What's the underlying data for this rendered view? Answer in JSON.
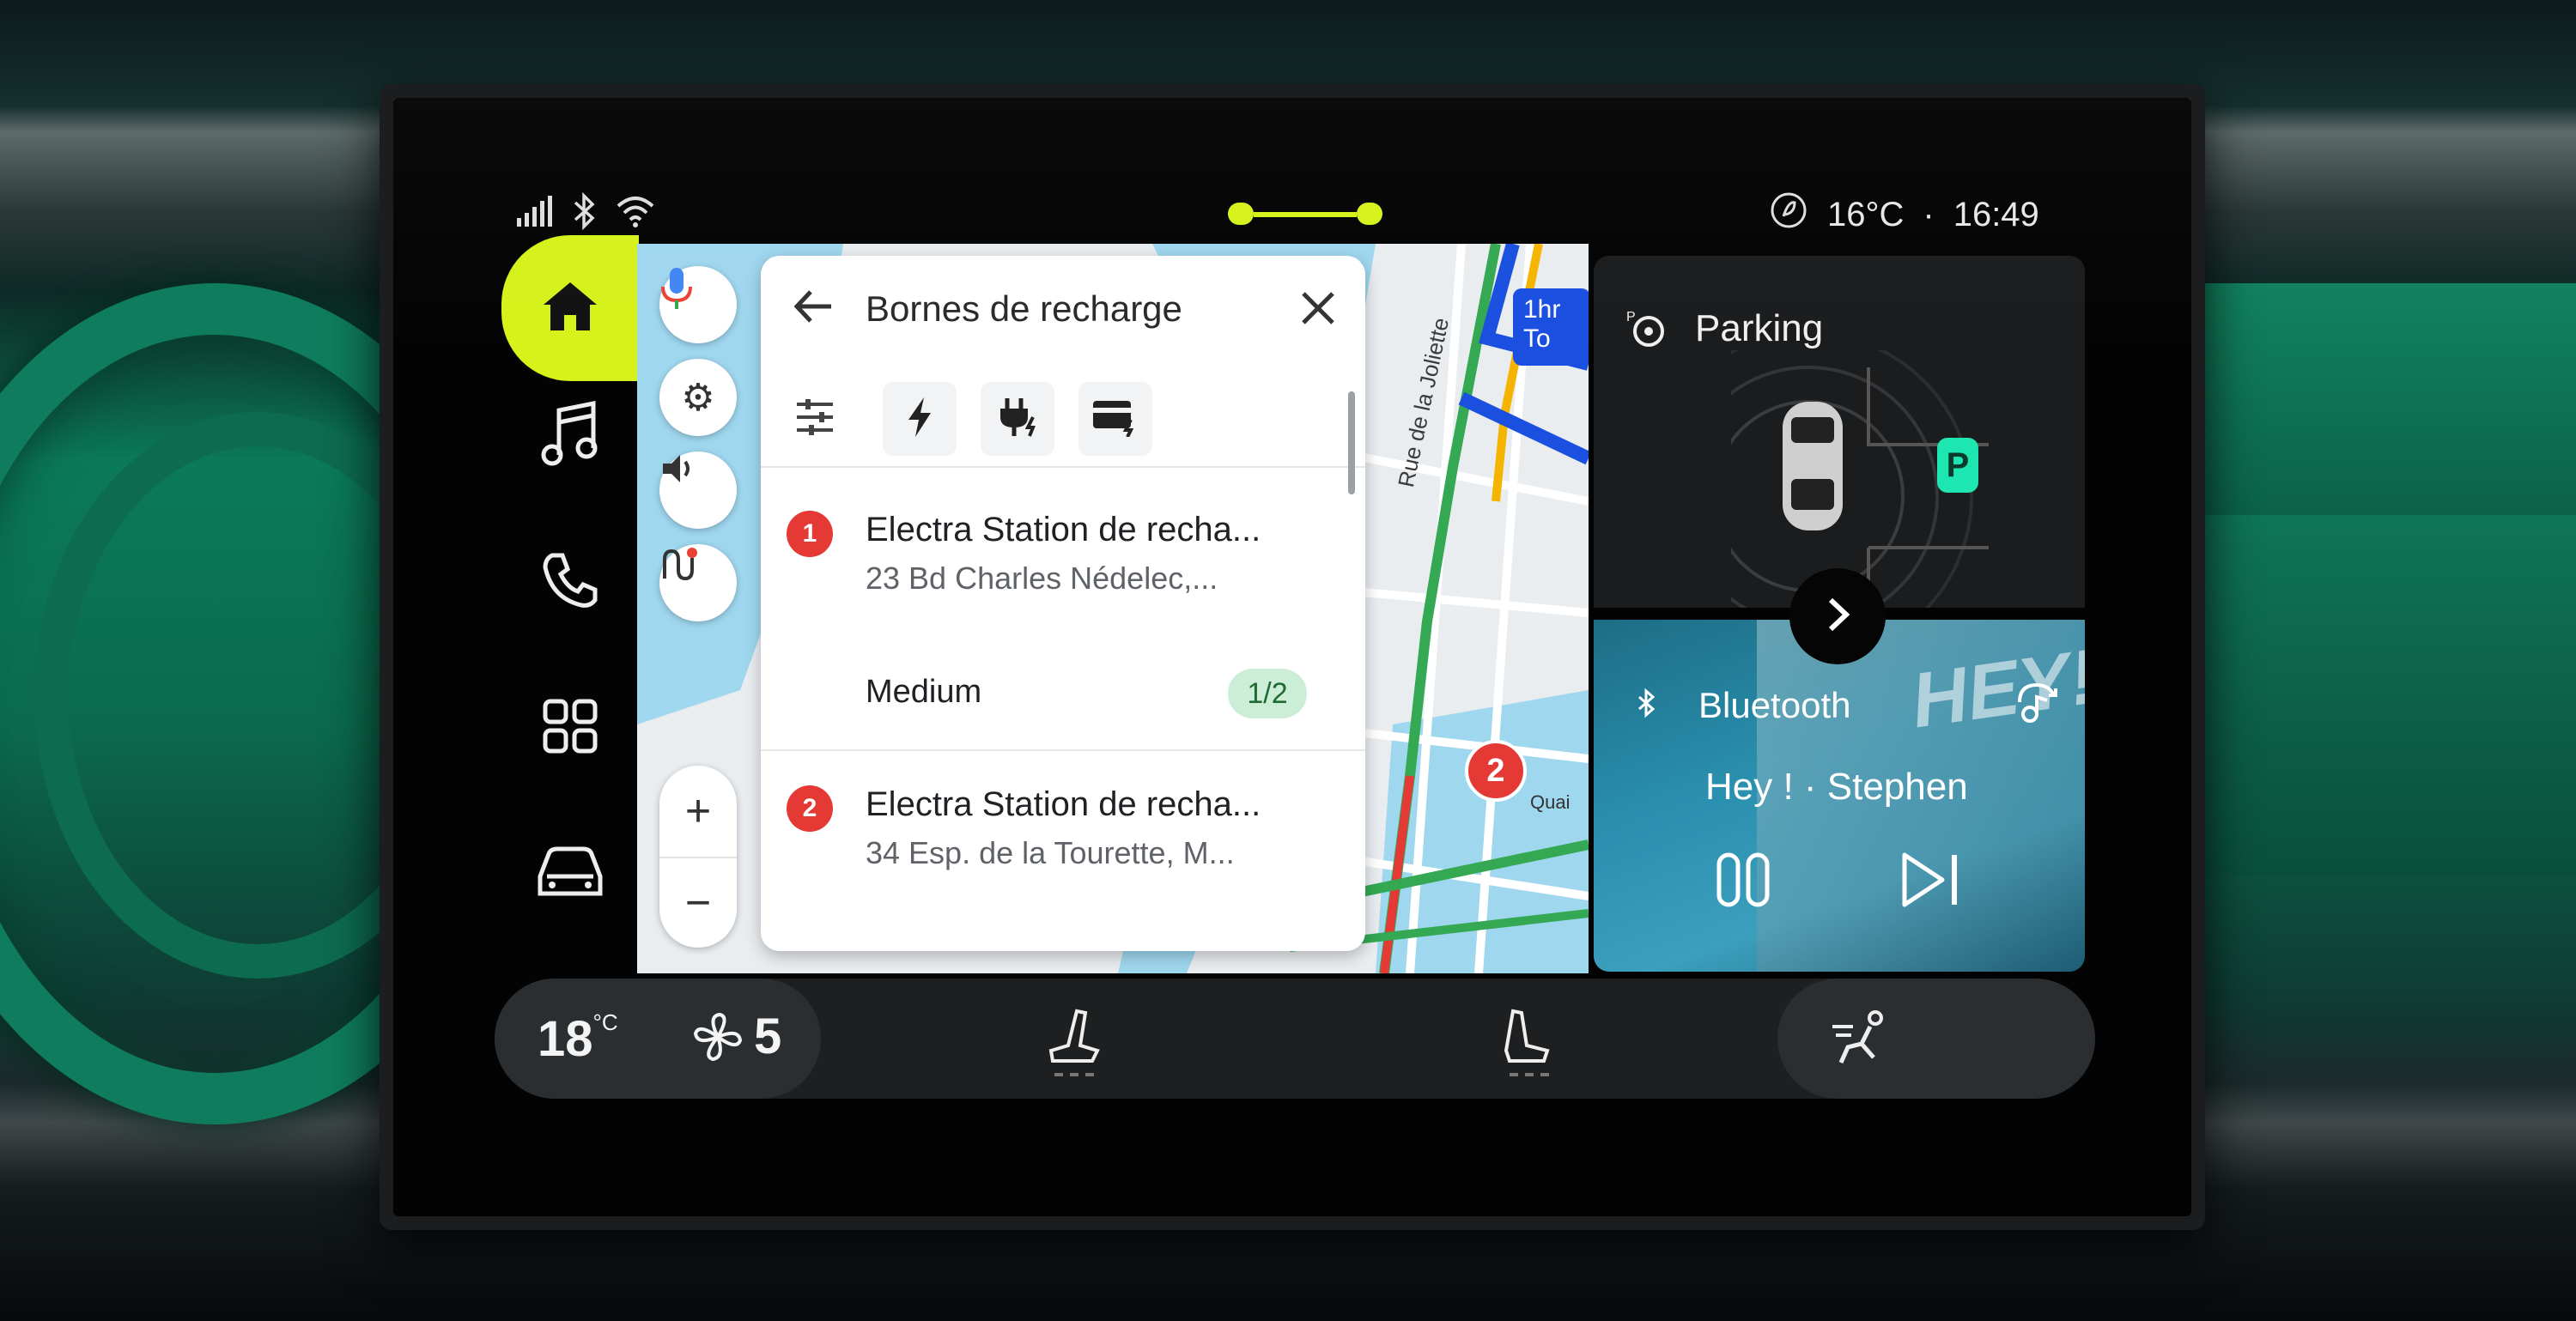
{
  "status_bar": {
    "signal_icon": "signal-icon",
    "bluetooth_icon": "bluetooth-icon",
    "wifi_icon": "wifi-icon",
    "temperature": "16°C",
    "separator": "·",
    "time": "16:49"
  },
  "sidebar": {
    "items": [
      {
        "name": "home",
        "icon": "home-icon",
        "active": true
      },
      {
        "name": "music",
        "icon": "music-note-icon"
      },
      {
        "name": "phone",
        "icon": "phone-icon"
      },
      {
        "name": "apps",
        "icon": "apps-grid-icon"
      },
      {
        "name": "vehicle",
        "icon": "car-icon"
      }
    ],
    "accent_color": "#d6f21a"
  },
  "map": {
    "eta_label": "1hr",
    "eta_sub": "To",
    "street_label": "Rue de la Joliette",
    "quai_label": "Quai",
    "marker_label": "2",
    "zoom_in": "+",
    "zoom_out": "−"
  },
  "search_panel": {
    "title": "Bornes de recharge",
    "results": [
      {
        "number": "1",
        "name": "Electra Station de recha...",
        "address": "23 Bd Charles Nédelec,...",
        "power": "Medium",
        "availability": "1/2"
      },
      {
        "number": "2",
        "name": "Electra Station de recha...",
        "address": "34 Esp. de la Tourette, M..."
      }
    ]
  },
  "parking_tile": {
    "title": "Parking",
    "parking_badge": "P"
  },
  "music_tile": {
    "source": "Bluetooth",
    "track": "Hey ! · Stephen",
    "album_text": "HEY!"
  },
  "climate": {
    "temperature": "18",
    "temp_unit": "°C",
    "fan_level": "5"
  }
}
